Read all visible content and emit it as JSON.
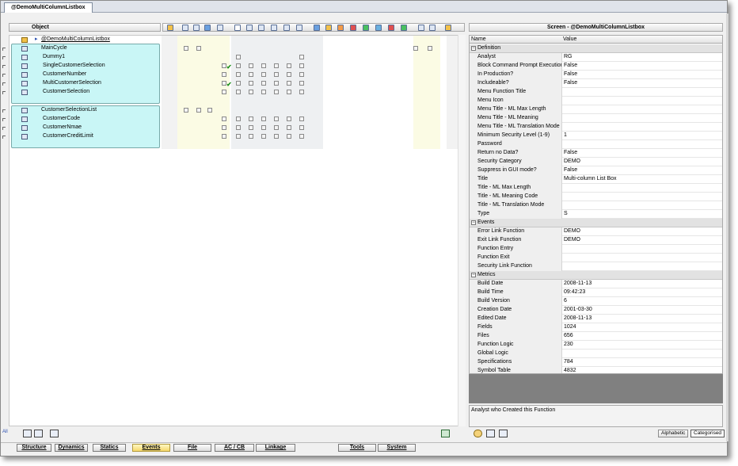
{
  "doc_tab": "@DemoMultiColumnListbox",
  "left_header": "Object",
  "right_header": "Screen - @DemoMultiColumnListbox",
  "tree": {
    "root": "@DemoMultiColumnListbox",
    "rows": [
      {
        "label": "MainCycle",
        "icon": "cycle-icon"
      },
      {
        "label": "Dummy1",
        "icon": "field-icon"
      },
      {
        "label": "SingleCustomerSelection",
        "icon": "listbox-icon"
      },
      {
        "label": "CustomerNumber",
        "icon": "field-icon"
      },
      {
        "label": "MultiCustomerSelection",
        "icon": "listbox-icon"
      },
      {
        "label": "CustomerSelection",
        "icon": "field-icon"
      },
      {
        "label": "CustomerSelectionList",
        "icon": "list-icon"
      },
      {
        "label": "CustomerCode",
        "icon": "field-icon"
      },
      {
        "label": "CustomerNmae",
        "icon": "field-icon"
      },
      {
        "label": "CustomerCreditLimit",
        "icon": "field-icon"
      }
    ]
  },
  "props": {
    "col_name": "Name",
    "col_value": "Value",
    "categories": [
      {
        "name": "Definition",
        "rows": [
          {
            "n": "Analyst",
            "v": "RG"
          },
          {
            "n": "Block Command Prompt Execution",
            "v": "False"
          },
          {
            "n": "In Production?",
            "v": "False"
          },
          {
            "n": "Includeable?",
            "v": "False"
          },
          {
            "n": "Menu Function Title",
            "v": ""
          },
          {
            "n": "Menu Icon",
            "v": ""
          },
          {
            "n": "Menu Title - ML Max Length",
            "v": ""
          },
          {
            "n": "Menu Title - ML Meaning",
            "v": ""
          },
          {
            "n": "Menu Title - ML Translation Mode",
            "v": ""
          },
          {
            "n": "Minimum Security Level (1-9)",
            "v": "1"
          },
          {
            "n": "Password",
            "v": ""
          },
          {
            "n": "Return no Data?",
            "v": "False"
          },
          {
            "n": "Security Category",
            "v": "DEMO"
          },
          {
            "n": "Suppress in GUI mode?",
            "v": "False"
          },
          {
            "n": "Title",
            "v": "Multi-column List Box"
          },
          {
            "n": "Title - ML Max Length",
            "v": ""
          },
          {
            "n": "Title - ML Meaning Code",
            "v": ""
          },
          {
            "n": "Title - ML Translation Mode",
            "v": ""
          },
          {
            "n": "Type",
            "v": "S"
          }
        ]
      },
      {
        "name": "Events",
        "rows": [
          {
            "n": "Error Link Function",
            "v": "DEMO"
          },
          {
            "n": "Exit Link Function",
            "v": "DEMO"
          },
          {
            "n": "Function Entry",
            "v": ""
          },
          {
            "n": "Function Exit",
            "v": ""
          },
          {
            "n": "Security Link Function",
            "v": ""
          }
        ]
      },
      {
        "name": "Metrics",
        "rows": [
          {
            "n": "Build Date",
            "v": "2008-11-13"
          },
          {
            "n": "Build Time",
            "v": "09:42:23"
          },
          {
            "n": "Build Version",
            "v": "6"
          },
          {
            "n": "Creation Date",
            "v": "2001-03-30"
          },
          {
            "n": "Edited Date",
            "v": "2008-11-13"
          },
          {
            "n": "Fields",
            "v": "1024"
          },
          {
            "n": "Files",
            "v": "656"
          },
          {
            "n": "Function Logic",
            "v": "230"
          },
          {
            "n": "Global Logic",
            "v": ""
          },
          {
            "n": "Specifications",
            "v": "784"
          },
          {
            "n": "Symbol Table",
            "v": "4832"
          }
        ]
      }
    ]
  },
  "description": "Analyst who Created this Function",
  "view_modes": {
    "alphabetic": "Alphabetic",
    "categorised": "Categorised"
  },
  "bottom_tabs": [
    "Structure",
    "Dynamics",
    "Statics",
    "Events",
    "File",
    "AC / CB",
    "Linkage",
    "Tools",
    "System"
  ],
  "active_tab": "Events",
  "left_status": "All",
  "colors": {
    "cyan_block": "#c9f6f6",
    "active_tab": "#f5d86a",
    "gray_panel": "#808080"
  }
}
